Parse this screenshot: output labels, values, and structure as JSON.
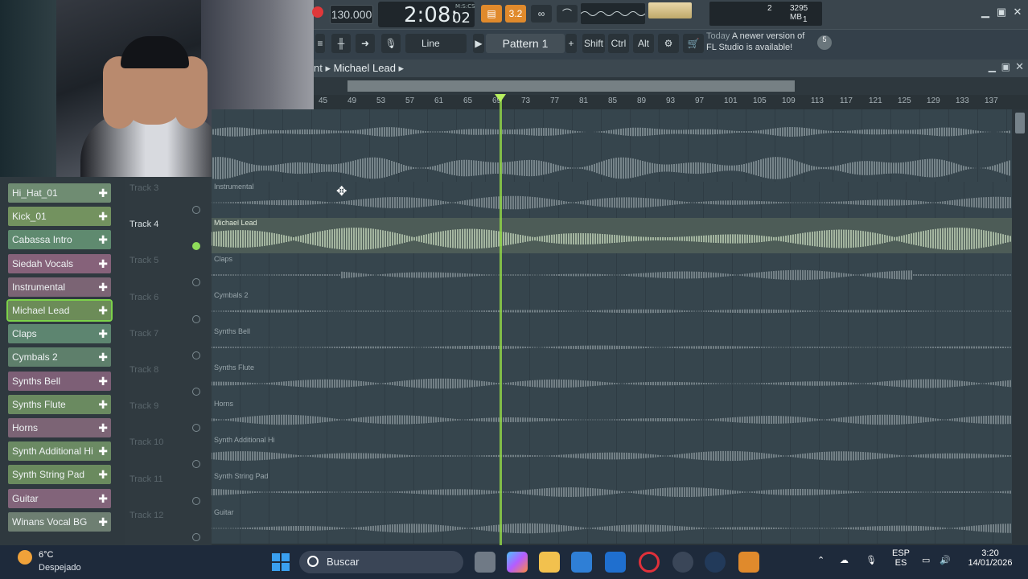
{
  "transport": {
    "tempo": "130.000",
    "time_main": "2:08:",
    "time_sub": "02",
    "time_unit": "M:S:CS",
    "cpu_value": "2",
    "memory": "3295 MB",
    "polyphony": "1"
  },
  "toolbar2": {
    "snap": "Line",
    "pattern": "Pattern 1",
    "shift": "Shift",
    "ctrl": "Ctrl",
    "alt": "Alt",
    "hint_today": "Today",
    "hint_line1": "A newer version of",
    "hint_line2": "FL Studio is available!",
    "hint_badge": "5"
  },
  "playlist": {
    "title_prefix": "nt",
    "title_current": "Michael Lead",
    "ruler": [
      "45",
      "49",
      "53",
      "57",
      "61",
      "65",
      "69",
      "73",
      "77",
      "81",
      "85",
      "89",
      "93",
      "97",
      "101",
      "105",
      "109",
      "113",
      "117",
      "121",
      "125",
      "129",
      "133",
      "137"
    ]
  },
  "channels": [
    {
      "name": "Hi_Hat_01",
      "color": "#6f8c72"
    },
    {
      "name": "Kick_01",
      "color": "#73925f"
    },
    {
      "name": "Cabassa Intro Cymbals",
      "color": "#5f8a6f"
    },
    {
      "name": "Siedah Vocals",
      "color": "#86627a"
    },
    {
      "name": "Instrumental",
      "color": "#7b6474"
    },
    {
      "name": "Michael Lead",
      "color": "#6c8c58"
    },
    {
      "name": "Claps",
      "color": "#5d8570"
    },
    {
      "name": "Cymbals 2",
      "color": "#5e7f6b"
    },
    {
      "name": "Synths Bell",
      "color": "#7d5f76"
    },
    {
      "name": "Synths Flute",
      "color": "#6a8a60"
    },
    {
      "name": "Horns",
      "color": "#7c6475"
    },
    {
      "name": "Synth Additional Hi",
      "color": "#6b8a63"
    },
    {
      "name": "Synth String Pad",
      "color": "#6a8a5e"
    },
    {
      "name": "Guitar",
      "color": "#82647a"
    },
    {
      "name": "Winans Vocal BG",
      "color": "#6e7f72"
    }
  ],
  "tracks": [
    {
      "name": "Track 3",
      "clip": "Instrumental"
    },
    {
      "name": "Track 4",
      "clip": "Michael Lead"
    },
    {
      "name": "Track 5",
      "clip": "Claps"
    },
    {
      "name": "Track 6",
      "clip": "Cymbals 2"
    },
    {
      "name": "Track 7",
      "clip": "Synths Bell"
    },
    {
      "name": "Track 8",
      "clip": "Synths Flute"
    },
    {
      "name": "Track 9",
      "clip": "Horns"
    },
    {
      "name": "Track 10",
      "clip": "Synth Additional Hi"
    },
    {
      "name": "Track 11",
      "clip": "Synth String Pad"
    },
    {
      "name": "Track 12",
      "clip": "Guitar"
    }
  ],
  "taskbar": {
    "temp": "6°C",
    "weather": "Despejado",
    "search": "Buscar",
    "lang1": "ESP",
    "lang2": "ES",
    "time": "3:20",
    "date": "14/01/2026"
  }
}
